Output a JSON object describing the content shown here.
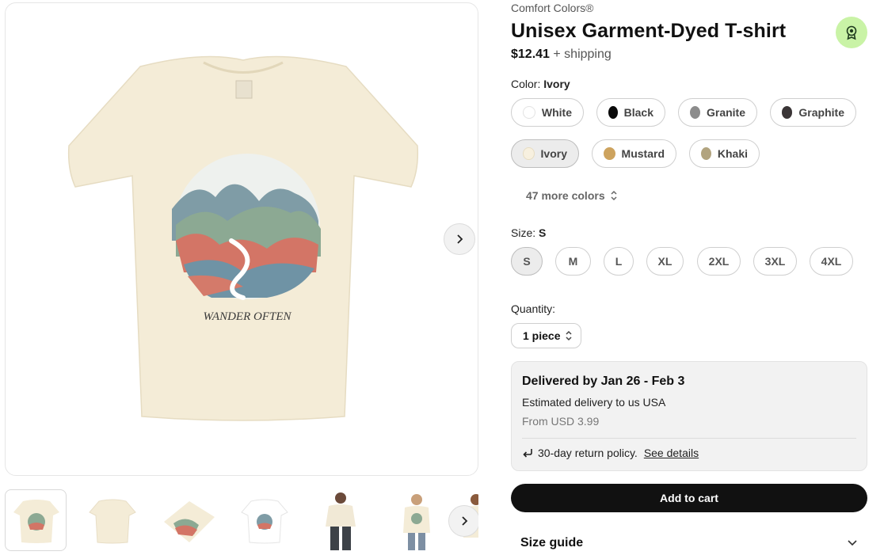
{
  "product": {
    "brand": "Comfort Colors®",
    "title": "Unisex Garment-Dyed T-shirt",
    "price": "$12.41",
    "shipping": "+ shipping",
    "print_text": "WANDER OFTEN"
  },
  "color": {
    "label": "Color:",
    "selected": "Ivory",
    "options": [
      {
        "name": "White",
        "hex": "#ffffff"
      },
      {
        "name": "Black",
        "hex": "#0a0a0a"
      },
      {
        "name": "Granite",
        "hex": "#8c8c8c"
      },
      {
        "name": "Graphite",
        "hex": "#3a3536"
      },
      {
        "name": "Ivory",
        "hex": "#f7f0df"
      },
      {
        "name": "Mustard",
        "hex": "#cda35e"
      },
      {
        "name": "Khaki",
        "hex": "#b2a47f"
      }
    ],
    "more_label": "47 more colors"
  },
  "size": {
    "label": "Size:",
    "selected": "S",
    "options": [
      "S",
      "M",
      "L",
      "XL",
      "2XL",
      "3XL",
      "4XL"
    ]
  },
  "quantity": {
    "label": "Quantity:",
    "value": "1 piece"
  },
  "delivery": {
    "title": "Delivered by Jan 26 - Feb 3",
    "estimate": "Estimated delivery to us USA",
    "from": "From USD 3.99",
    "return_policy": "30-day return policy.",
    "see_details": "See details"
  },
  "actions": {
    "add_to_cart": "Add to cart",
    "size_guide": "Size guide"
  },
  "colors": {
    "accent_badge": "#c9f3a6",
    "shirt_ivory": "#f6efdc",
    "primary_button": "#111111"
  },
  "icons": {
    "badge": "award-ribbon-icon",
    "next": "chevron-right-icon",
    "sort": "chevron-up-down-icon",
    "return": "return-arrow-icon",
    "expand": "chevron-down-icon"
  }
}
